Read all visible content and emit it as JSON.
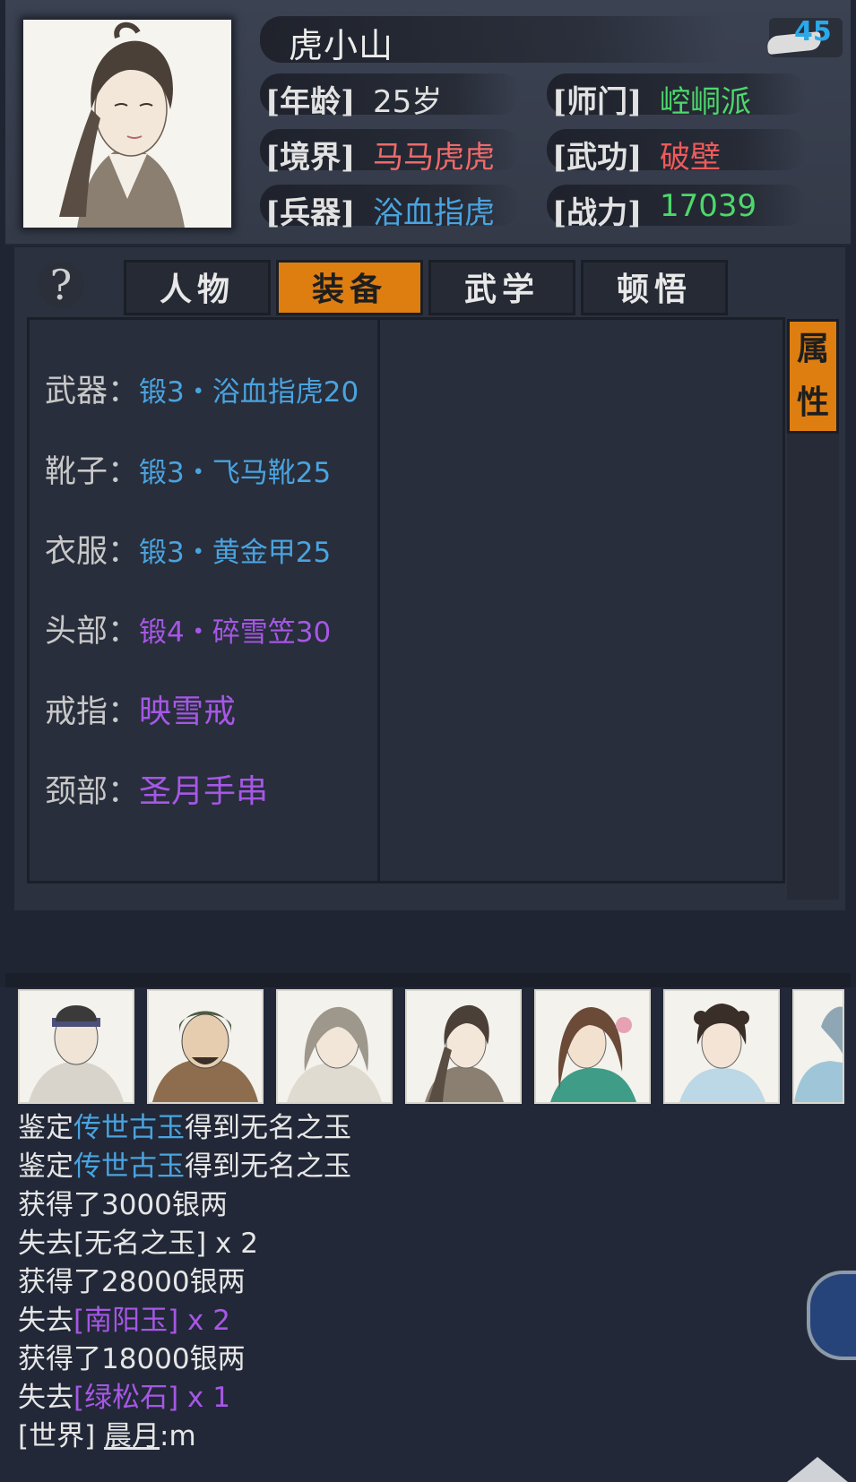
{
  "character": {
    "name": "虎小山",
    "level": "45",
    "info": [
      {
        "label": "[年龄]",
        "value": "25岁",
        "color": "#e2e2e2"
      },
      {
        "label": "[师门]",
        "value": "崆峒派",
        "color": "#4dd86b"
      },
      {
        "label": "[境界]",
        "value": "马马虎虎",
        "color": "#ee6b6b"
      },
      {
        "label": "[武功]",
        "value": "破壁",
        "color": "#ee5a5a"
      },
      {
        "label": "[兵器]",
        "value": "浴血指虎",
        "color": "#4aa3df"
      },
      {
        "label": "[战力]",
        "value": "17039",
        "color": "#4dd86b"
      }
    ]
  },
  "help": {
    "icon": "question-icon",
    "glyph": "?"
  },
  "tabs": [
    {
      "label": "人物",
      "active": false
    },
    {
      "label": "装备",
      "active": true
    },
    {
      "label": "武学",
      "active": false
    },
    {
      "label": "顿悟",
      "active": false
    }
  ],
  "attr_tab": {
    "label_1": "属",
    "label_2": "性"
  },
  "equipment": [
    {
      "slot": "武器：",
      "item": "锻3・浴血指虎20",
      "color": "#4aa3df"
    },
    {
      "slot": "靴子：",
      "item": "锻3・飞马靴25",
      "color": "#4aa3df"
    },
    {
      "slot": "衣服：",
      "item": "锻3・黄金甲25",
      "color": "#4aa3df"
    },
    {
      "slot": "头部：",
      "item": "锻4・碎雪笠30",
      "color": "#a657e6"
    },
    {
      "slot": "戒指：",
      "item": "映雪戒",
      "color": "#a657e6"
    },
    {
      "slot": "颈部：",
      "item": "圣月手串",
      "color": "#a657e6"
    }
  ],
  "log": [
    {
      "parts": [
        {
          "t": "鉴定",
          "c": ""
        },
        {
          "t": "传世古玉",
          "c": "c-blue"
        },
        {
          "t": "得到无名之玉",
          "c": ""
        }
      ]
    },
    {
      "parts": [
        {
          "t": "鉴定",
          "c": ""
        },
        {
          "t": "传世古玉",
          "c": "c-blue"
        },
        {
          "t": "得到无名之玉",
          "c": ""
        }
      ]
    },
    {
      "parts": [
        {
          "t": "获得了3000银两",
          "c": ""
        }
      ]
    },
    {
      "parts": [
        {
          "t": "失去[无名之玉] x 2",
          "c": ""
        }
      ]
    },
    {
      "parts": [
        {
          "t": "获得了28000银两",
          "c": ""
        }
      ]
    },
    {
      "parts": [
        {
          "t": "失去",
          "c": ""
        },
        {
          "t": "[南阳玉] x 2",
          "c": "c-purple"
        }
      ]
    },
    {
      "parts": [
        {
          "t": "获得了18000银两",
          "c": ""
        }
      ]
    },
    {
      "parts": [
        {
          "t": "失去",
          "c": ""
        },
        {
          "t": "[绿松石] x 1",
          "c": "c-purple"
        }
      ]
    },
    {
      "parts": [
        {
          "t": "[世界] ",
          "c": ""
        },
        {
          "t": "晨月",
          "c": "world-name"
        },
        {
          "t": ":m",
          "c": ""
        }
      ]
    }
  ],
  "colors": {
    "accent": "#de7e11",
    "blue_item": "#4aa3df",
    "purple_item": "#a657e6",
    "level": "#29a9e8"
  }
}
